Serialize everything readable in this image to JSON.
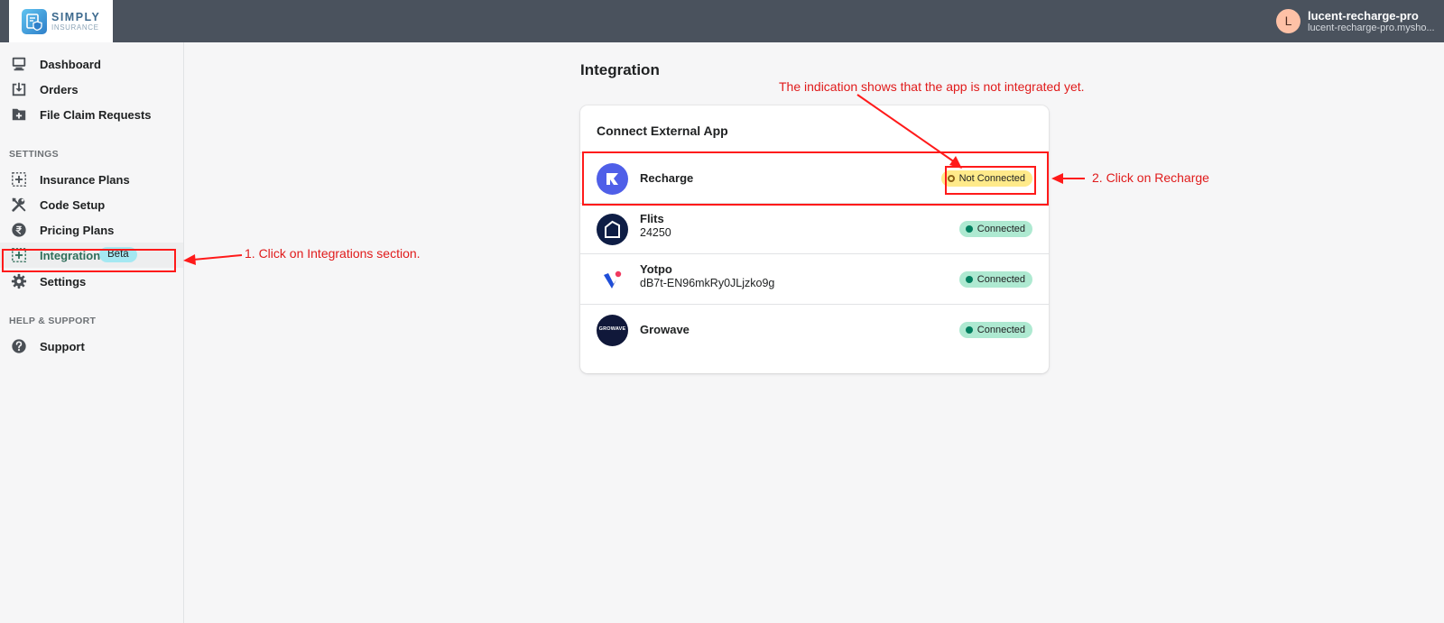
{
  "header": {
    "logo_line1": "SIMPLY",
    "logo_line2": "INSURANCE",
    "avatar_initial": "L",
    "store_name": "lucent-recharge-pro",
    "store_url": "lucent-recharge-pro.mysho..."
  },
  "sidebar": {
    "main_items": [
      {
        "label": "Dashboard",
        "icon": "monitor-icon"
      },
      {
        "label": "Orders",
        "icon": "download-icon"
      },
      {
        "label": "File Claim Requests",
        "icon": "folder-plus-icon"
      }
    ],
    "settings_heading": "SETTINGS",
    "settings_items": [
      {
        "label": "Insurance Plans",
        "icon": "dashed-plus-icon"
      },
      {
        "label": "Code Setup",
        "icon": "tools-icon"
      },
      {
        "label": "Pricing Plans",
        "icon": "rupee-icon"
      },
      {
        "label": "Integration",
        "icon": "dashed-plus-icon",
        "badge": "Beta",
        "active": true
      },
      {
        "label": "Settings",
        "icon": "gear-icon"
      }
    ],
    "help_heading": "HELP & SUPPORT",
    "help_items": [
      {
        "label": "Support",
        "icon": "question-icon"
      }
    ]
  },
  "main": {
    "title": "Integration",
    "card_title": "Connect External App",
    "apps": [
      {
        "name": "Recharge",
        "sub": "",
        "status": "Not Connected",
        "logo": "recharge-logo-icon"
      },
      {
        "name": "Flits",
        "sub": "24250",
        "status": "Connected",
        "logo": "flits-logo-icon"
      },
      {
        "name": "Yotpo",
        "sub": "dB7t-EN96mkRy0JLjzko9g",
        "status": "Connected",
        "logo": "yotpo-logo-icon"
      },
      {
        "name": "Growave",
        "sub": "",
        "status": "Connected",
        "logo": "growave-logo-icon",
        "logo_text": "GROWAVE"
      }
    ]
  },
  "annotations": {
    "step1": "1. Click on Integrations section.",
    "step2": "2. Click on Recharge",
    "indication": "The indication shows that the app is not integrated yet."
  },
  "colors": {
    "topbar": "#4a525d",
    "annotation": "#ff1a1a",
    "connected_bg": "#aee9d1",
    "not_connected_bg": "#ffea8a",
    "beta_bg": "#a4e8f2"
  }
}
